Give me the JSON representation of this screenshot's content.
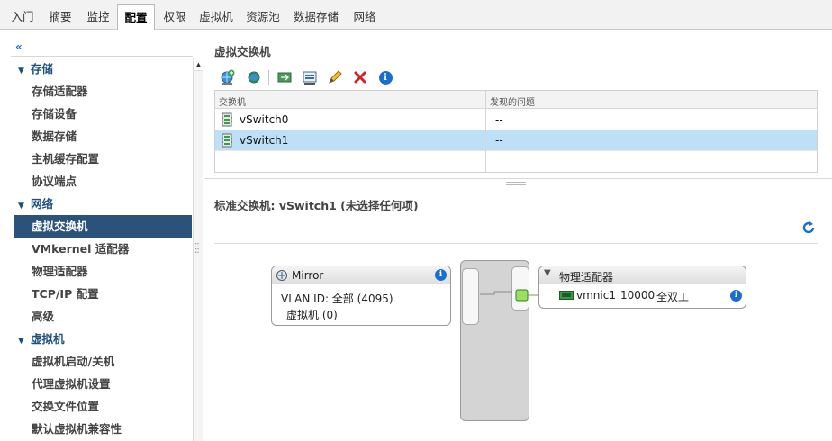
{
  "tabs": [
    {
      "label": "入门",
      "active": false
    },
    {
      "label": "摘要",
      "active": false
    },
    {
      "label": "监控",
      "active": false
    },
    {
      "label": "配置",
      "active": true
    },
    {
      "label": "权限",
      "active": false
    },
    {
      "label": "虚拟机",
      "active": false
    },
    {
      "label": "资源池",
      "active": false
    },
    {
      "label": "数据存储",
      "active": false
    },
    {
      "label": "网络",
      "active": false
    }
  ],
  "sidebar": {
    "collapse_label": "«",
    "groups": [
      {
        "label": "存储",
        "items": [
          "存储适配器",
          "存储设备",
          "数据存储",
          "主机缓存配置",
          "协议端点"
        ]
      },
      {
        "label": "网络",
        "items": [
          "虚拟交换机",
          "VMkernel 适配器",
          "物理适配器",
          "TCP/IP 配置",
          "高级"
        ]
      },
      {
        "label": "虚拟机",
        "items": [
          "虚拟机启动/关机",
          "代理虚拟机设置",
          "交换文件位置",
          "默认虚拟机兼容性"
        ]
      }
    ],
    "selected_item": "虚拟交换机"
  },
  "main": {
    "title": "虚拟交换机",
    "toolbar_icons": [
      "add-networking-icon",
      "refresh-network-icon",
      "migrate-adapter-icon",
      "manage-adapters-icon",
      "edit-icon",
      "delete-icon",
      "info-icon"
    ],
    "table": {
      "columns": [
        "交换机",
        "发现的问题"
      ],
      "rows": [
        {
          "name": "vSwitch0",
          "issue": "--",
          "selected": false
        },
        {
          "name": "vSwitch1",
          "issue": "--",
          "selected": true
        }
      ]
    },
    "detail_title": "标准交换机: vSwitch1 (未选择任何项)"
  },
  "diagram": {
    "portgroup": {
      "name": "Mirror",
      "vlan": "VLAN ID: 全部 (4095)",
      "vms": "虚拟机 (0)"
    },
    "physical": {
      "title": "物理适配器",
      "adapter": "vmnic1",
      "speed": "10000",
      "duplex": "全双工"
    }
  },
  "colors": {
    "selected_nav": "#2a527a",
    "selected_row": "#bde0f7",
    "accent": "#1a6ed0"
  }
}
